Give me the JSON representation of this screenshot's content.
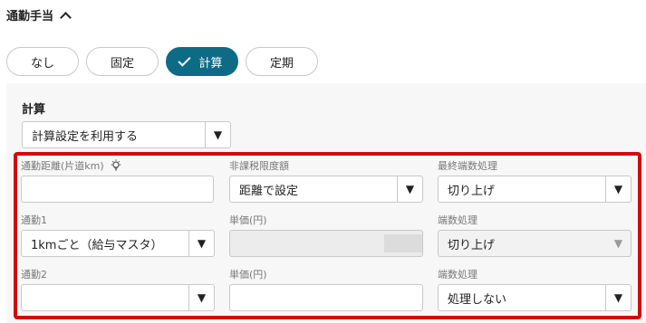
{
  "section": {
    "title": "通勤手当"
  },
  "segments": [
    {
      "label": "なし",
      "active": false
    },
    {
      "label": "固定",
      "active": false
    },
    {
      "label": "計算",
      "active": true
    },
    {
      "label": "定期",
      "active": false
    }
  ],
  "panel": {
    "title": "計算",
    "calc_setting": {
      "value": "計算設定を利用する"
    }
  },
  "fields": {
    "distance": {
      "label": "通勤距離(片道km)",
      "value": ""
    },
    "tax_limit": {
      "label": "非課税限度額",
      "value": "距離で設定"
    },
    "final_rounding": {
      "label": "最終端数処理",
      "value": "切り上げ"
    },
    "commute1": {
      "label": "通勤1",
      "value": "1kmごと（給与マスタ）"
    },
    "unit_price1": {
      "label": "単価(円)",
      "value": ""
    },
    "rounding1": {
      "label": "端数処理",
      "value": "切り上げ"
    },
    "commute2": {
      "label": "通勤2",
      "value": ""
    },
    "unit_price2": {
      "label": "単価(円)",
      "value": ""
    },
    "rounding2": {
      "label": "端数処理",
      "value": "処理しない"
    }
  },
  "colors": {
    "accent": "#0e6b86",
    "highlight": "#d10a10"
  }
}
